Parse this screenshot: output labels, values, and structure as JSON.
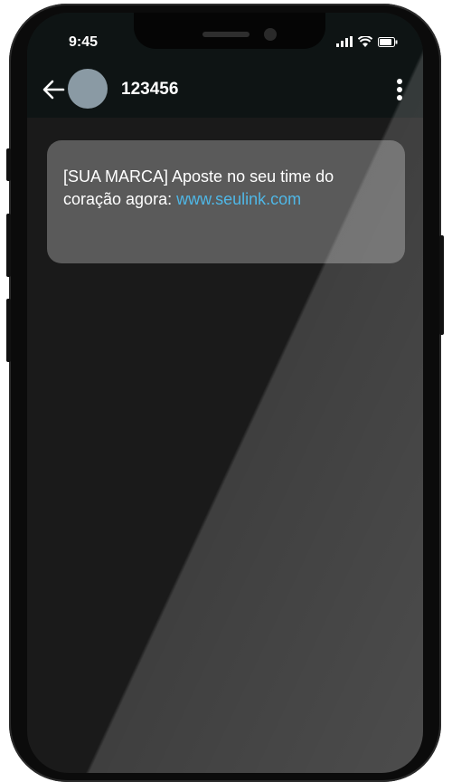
{
  "status_bar": {
    "time": "9:45"
  },
  "header": {
    "contact": "123456"
  },
  "message": {
    "text": "[SUA MARCA] Aposte no seu time do coração agora: ",
    "link": "www.seulink.com"
  },
  "icons": {
    "back": "arrow-left-icon",
    "menu": "more-vert-icon",
    "signal": "signal-icon",
    "wifi": "wifi-icon",
    "battery": "battery-icon"
  },
  "colors": {
    "link": "#4fb7e6",
    "bubble": "#5a5a5a",
    "header": "#0e1414"
  }
}
